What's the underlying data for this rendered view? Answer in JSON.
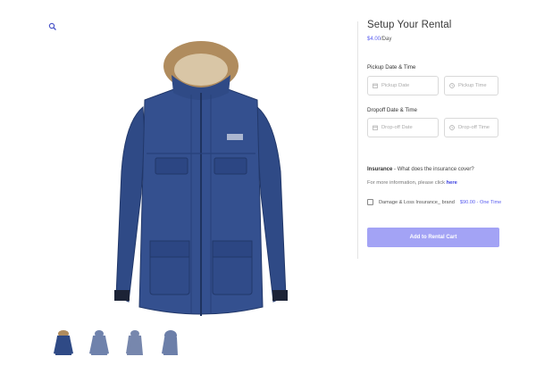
{
  "product": {
    "images": [
      "front",
      "back",
      "side",
      "hood"
    ]
  },
  "rental": {
    "title": "Setup Your Rental",
    "price": "$4.00",
    "price_unit": "/Day",
    "pickup_label": "Pickup Date & Time",
    "pickup_date_placeholder": "Pickup Date",
    "pickup_time_placeholder": "Pickup Time",
    "dropoff_label": "Dropoff Date & Time",
    "dropoff_date_placeholder": "Drop-off Date",
    "dropoff_time_placeholder": "Drop-off Time"
  },
  "insurance": {
    "label": "Insurance",
    "question": " - What does the insurance cover?",
    "more_info": "For more information, please click ",
    "link": "here",
    "option_label": "Damage & Loss Insurance_ brand",
    "option_price": "$90.00 - One Time",
    "checked": false
  },
  "actions": {
    "add_to_cart": "Add to Rental Cart"
  },
  "colors": {
    "accent": "#5a5ef0",
    "button": "#a3a3f5",
    "jacket": "#2f4a86",
    "fur": "#b08c5e"
  }
}
